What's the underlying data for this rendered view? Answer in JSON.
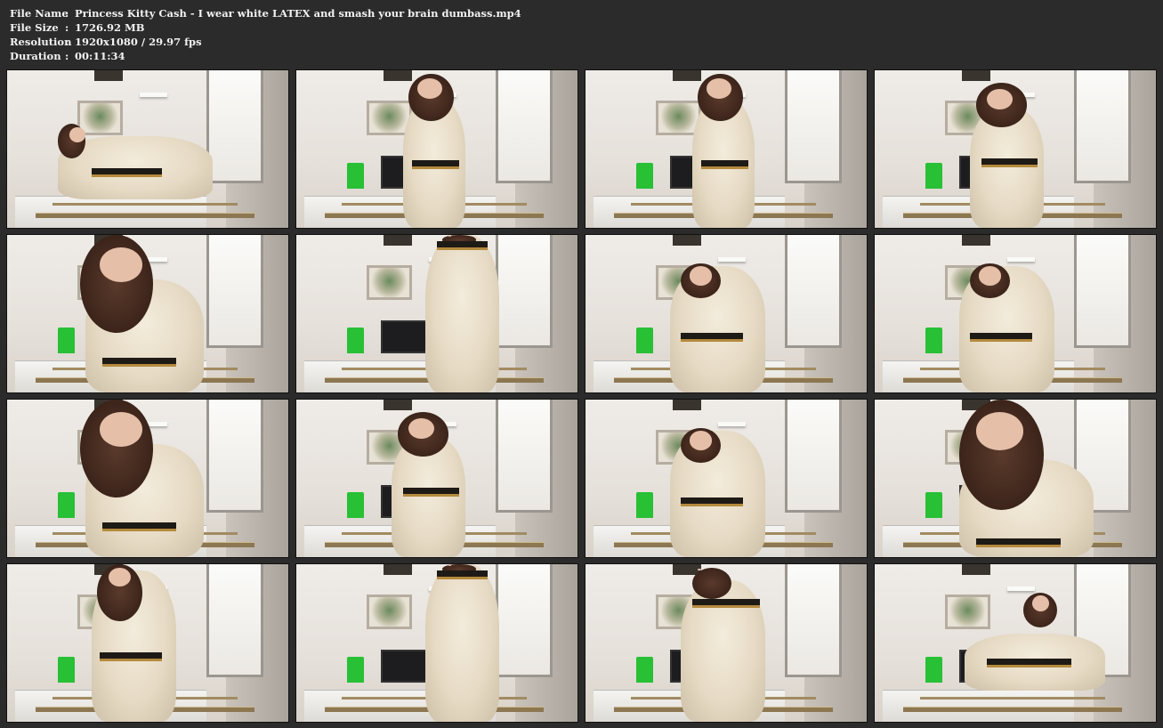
{
  "info": {
    "rows": [
      {
        "label": "File Name",
        "sep": ":",
        "value": "Princess Kitty Cash - I wear white LATEX and smash your brain dumbass.mp4"
      },
      {
        "label": "File Size",
        "sep": ":",
        "value": "1726.92 MB"
      },
      {
        "label": "Resolution",
        "sep": ":",
        "value": "1920x1080 / 29.97 fps"
      },
      {
        "label": "Duration",
        "sep": ":",
        "value": "00:11:34"
      }
    ]
  },
  "colors": {
    "background": "#2b2b2b",
    "text": "#f2f2f2",
    "thumb_border": "#111111"
  },
  "thumbnails": [
    {
      "pose": "reclining-left"
    },
    {
      "pose": "standing-center"
    },
    {
      "pose": "standing-center"
    },
    {
      "pose": "seated-center"
    },
    {
      "pose": "close-left"
    },
    {
      "pose": "back-center"
    },
    {
      "pose": "foot-raised"
    },
    {
      "pose": "foot-raised"
    },
    {
      "pose": "close-left"
    },
    {
      "pose": "seated-center"
    },
    {
      "pose": "foot-raised"
    },
    {
      "pose": "close-center"
    },
    {
      "pose": "standing-left"
    },
    {
      "pose": "back-center"
    },
    {
      "pose": "back-bend"
    },
    {
      "pose": "reclining-right"
    }
  ]
}
